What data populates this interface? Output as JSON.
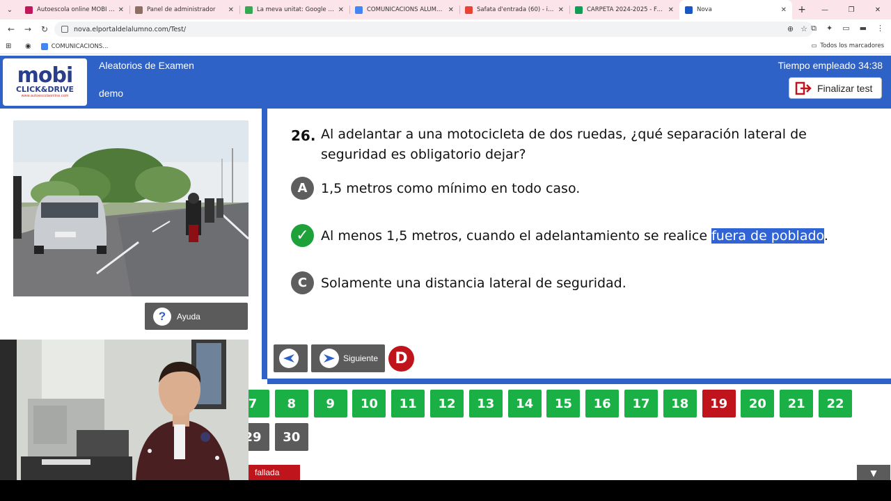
{
  "browser": {
    "tabs": [
      {
        "title": "Autoescola online MOBI | L'aut",
        "color": "#c2185b"
      },
      {
        "title": "Panel de administrador",
        "color": "#8d6e63"
      },
      {
        "title": "La meva unitat: Google Drive",
        "color": "#34a853"
      },
      {
        "title": "COMUNICACIONS ALUMNES -",
        "color": "#4285f4"
      },
      {
        "title": "Safata d'entrada (60) - info@a",
        "color": "#ea4335"
      },
      {
        "title": "CARPETA 2024-2025 - Fulls de",
        "color": "#0f9d58"
      },
      {
        "title": "Nova",
        "color": "#1a56c4",
        "active": true
      }
    ],
    "url": "nova.elportaldelalumno.com/Test/",
    "bookmark": "COMUNICACIONS...",
    "all_bookmarks": "Todos los marcadores"
  },
  "header": {
    "logo_main": "mobi",
    "logo_sub": "CLICK&DRIVE",
    "logo_url": "www.autoescolaonline.com",
    "title": "Aleatorios de Examen",
    "subtitle": "demo",
    "time_label": "Tiempo empleado 34:38",
    "finish_label": "Finalizar test"
  },
  "left": {
    "help_label": "Ayuda"
  },
  "question": {
    "number": "26.",
    "text": "Al adelantar a una motocicleta de dos ruedas, ¿qué separación lateral de seguridad es obligatorio dejar?",
    "options": [
      {
        "letter": "A",
        "text": "1,5 metros como mínimo en todo caso.",
        "correct": false
      },
      {
        "letter": "✓",
        "text_before": "Al menos 1,5 metros, cuando el adelantamiento se realice ",
        "text_highlight": "fuera de poblado",
        "text_after": ".",
        "correct": true
      },
      {
        "letter": "C",
        "text": "Solamente una distancia lateral de seguridad.",
        "correct": false
      }
    ]
  },
  "nav": {
    "next_label": "Siguiente",
    "d_badge": "D"
  },
  "grid": {
    "row1": [
      {
        "n": "7",
        "status": "green"
      },
      {
        "n": "8",
        "status": "green"
      },
      {
        "n": "9",
        "status": "green"
      },
      {
        "n": "10",
        "status": "green"
      },
      {
        "n": "11",
        "status": "green"
      },
      {
        "n": "12",
        "status": "green"
      },
      {
        "n": "13",
        "status": "green"
      },
      {
        "n": "14",
        "status": "green"
      },
      {
        "n": "15",
        "status": "green"
      },
      {
        "n": "16",
        "status": "green"
      },
      {
        "n": "17",
        "status": "green"
      },
      {
        "n": "18",
        "status": "green"
      },
      {
        "n": "19",
        "status": "red"
      },
      {
        "n": "20",
        "status": "green"
      },
      {
        "n": "21",
        "status": "green"
      },
      {
        "n": "22",
        "status": "green"
      }
    ],
    "row2": [
      {
        "n": "29",
        "status": "grey"
      },
      {
        "n": "30",
        "status": "grey"
      }
    ],
    "legend_failed": "fallada"
  },
  "colors": {
    "brand_blue": "#2e62c7",
    "correct_green": "#1bb046",
    "failed_red": "#c0141c",
    "neutral_grey": "#5b5b5b"
  }
}
